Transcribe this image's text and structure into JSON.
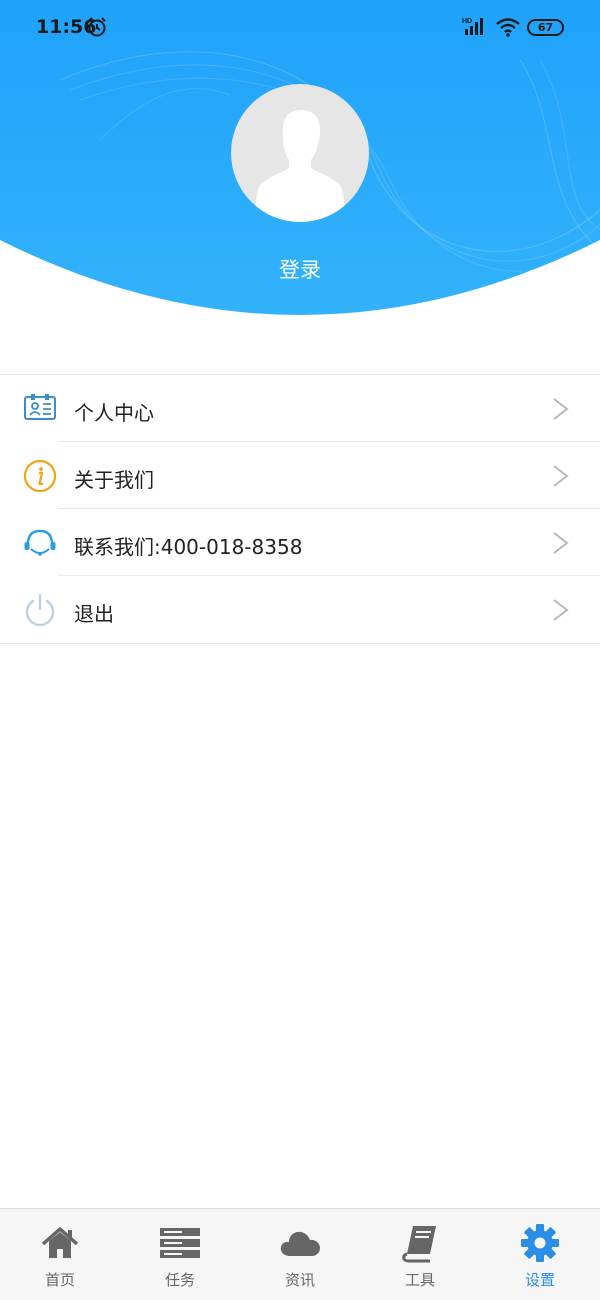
{
  "status_bar": {
    "time": "11:56",
    "battery": "67",
    "network_badge": "HD"
  },
  "header": {
    "login_label": "登录"
  },
  "menu": {
    "items": [
      {
        "label": "个人中心",
        "icon": "id-card-icon"
      },
      {
        "label": "关于我们",
        "icon": "info-icon"
      },
      {
        "label": "联系我们:400-018-8358",
        "icon": "headset-icon"
      },
      {
        "label": "退出",
        "icon": "power-icon"
      }
    ]
  },
  "tabbar": {
    "tabs": [
      {
        "label": "首页",
        "icon": "home-icon",
        "active": false
      },
      {
        "label": "任务",
        "icon": "server-list-icon",
        "active": false
      },
      {
        "label": "资讯",
        "icon": "cloud-icon",
        "active": false
      },
      {
        "label": "工具",
        "icon": "book-icon",
        "active": false
      },
      {
        "label": "设置",
        "icon": "gear-icon",
        "active": true
      }
    ]
  },
  "colors": {
    "header_blue": "#26a8fa",
    "header_blue_dark": "#1d97f0",
    "active_tab": "#2a8ee6",
    "inactive_tab": "#666666",
    "info_icon": "#f0a514",
    "id_card_icon": "#3b8fc8",
    "headset_icon": "#2a9fe0",
    "power_icon": "#b9cddb"
  }
}
